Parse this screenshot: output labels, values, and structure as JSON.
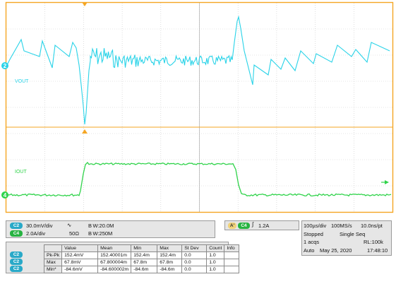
{
  "scope": {
    "colors": {
      "ch2": "#29d3e8",
      "ch4": "#2fd34a",
      "frame": "#f5a623",
      "grid": "#c9c9c9"
    },
    "ch2_label": "VOUT",
    "ch4_label": "IOUT",
    "ch2_marker": "2",
    "ch4_marker": "4",
    "trigger_marker_icon": "trigger-position-icon"
  },
  "channels": [
    {
      "id": "C2",
      "scale": "30.0mV/div",
      "coupling_icon": "ac-coupling-icon",
      "bw": "B W:20.0M"
    },
    {
      "id": "C4",
      "scale": "2.0A/div",
      "coupling": "50Ω",
      "bw": "B W:250M"
    }
  ],
  "trigger": {
    "mode": "A'",
    "channel": "C4",
    "slope_icon": "rising-edge-icon",
    "level": "1.2A"
  },
  "timebase": {
    "horizontal": "100µs/div",
    "sample_rate": "100MS/s",
    "resolution": "10.0ns/pt",
    "state": "Stopped",
    "seq": "Single Seq",
    "acqs": "1 acqs",
    "record_length": "RL:100k",
    "auto": "Auto",
    "date": "May 25, 2020",
    "time": "17:48:10"
  },
  "measurements": {
    "headers": [
      "",
      "",
      "Value",
      "Mean",
      "Min",
      "Max",
      "St Dev",
      "Count",
      "Info"
    ],
    "rows": [
      {
        "ch": "C2",
        "name": "Pk-Pk",
        "value": "152.4mV",
        "mean": "152.40001m",
        "min": "152.4m",
        "max": "152.4m",
        "stdev": "0.0",
        "count": "1.0",
        "info": ""
      },
      {
        "ch": "C2",
        "name": "Max",
        "value": "67.8mV",
        "mean": "67.800004m",
        "min": "67.8m",
        "max": "67.8m",
        "stdev": "0.0",
        "count": "1.0",
        "info": ""
      },
      {
        "ch": "C2",
        "name": "Min*",
        "value": "-84.6mV",
        "mean": "-84.600002m",
        "min": "-84.6m",
        "max": "-84.6m",
        "stdev": "0.0",
        "count": "1.0",
        "info": ""
      }
    ]
  }
}
